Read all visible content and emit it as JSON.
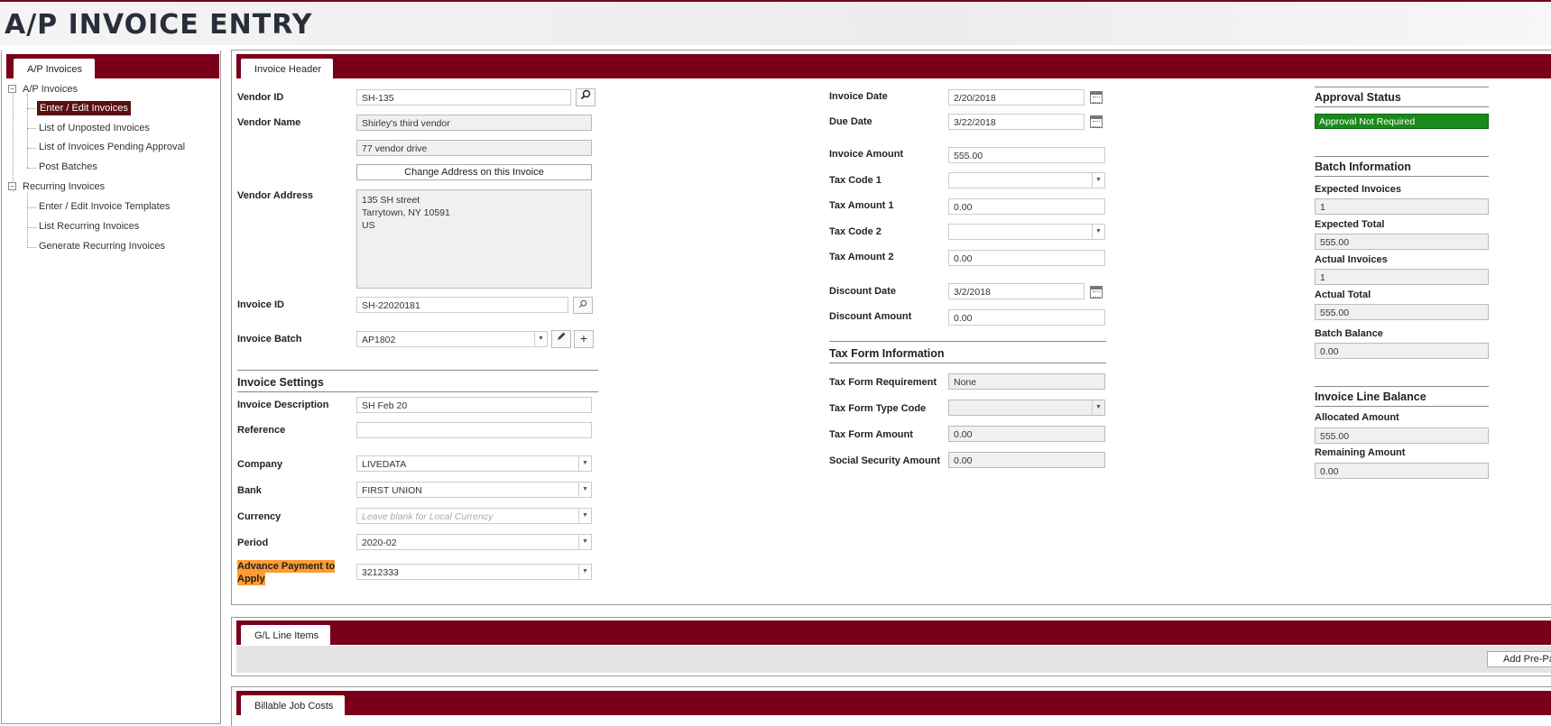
{
  "app": {
    "title": "A/P INVOICE ENTRY"
  },
  "sidebar": {
    "tab": "A/P Invoices",
    "groups": [
      {
        "label": "A/P Invoices",
        "items": [
          "Enter / Edit Invoices",
          "List of Unposted Invoices",
          "List of Invoices Pending Approval",
          "Post Batches"
        ]
      },
      {
        "label": "Recurring Invoices",
        "items": [
          "Enter / Edit Invoice Templates",
          "List Recurring Invoices",
          "Generate Recurring Invoices"
        ]
      }
    ],
    "selected": "Enter / Edit Invoices"
  },
  "header_tab": "Invoice Header",
  "vendor": {
    "id_label": "Vendor ID",
    "id_value": "SH-135",
    "name_label": "Vendor Name",
    "name_value": "Shirley's third vendor",
    "address2_value": "77 vendor drive",
    "change_address_button": "Change Address on this Invoice",
    "address_label": "Vendor Address",
    "address_lines": [
      "135 SH street",
      "Tarrytown, NY 10591",
      "US"
    ]
  },
  "invoice": {
    "id_label": "Invoice ID",
    "id_value": "SH-22020181",
    "batch_label": "Invoice Batch",
    "batch_value": "AP1802"
  },
  "settings": {
    "title": "Invoice Settings",
    "description_label": "Invoice Description",
    "description_value": "SH Feb 20",
    "reference_label": "Reference",
    "reference_value": "",
    "company_label": "Company",
    "company_value": "LIVEDATA",
    "bank_label": "Bank",
    "bank_value": "FIRST UNION",
    "currency_label": "Currency",
    "currency_placeholder": "Leave blank for Local Currency",
    "period_label": "Period",
    "period_value": "2020-02",
    "advance_label_1": "Advance Payment to",
    "advance_label_2": "Apply",
    "advance_value": "3212333"
  },
  "dates": {
    "invoice_date_label": "Invoice Date",
    "invoice_date_value": "2/20/2018",
    "due_date_label": "Due Date",
    "due_date_value": "3/22/2018",
    "invoice_amount_label": "Invoice Amount",
    "invoice_amount_value": "555.00",
    "tax_code1_label": "Tax Code 1",
    "tax_code1_value": "",
    "tax_amount1_label": "Tax Amount 1",
    "tax_amount1_value": "0.00",
    "tax_code2_label": "Tax Code 2",
    "tax_code2_value": "",
    "tax_amount2_label": "Tax Amount 2",
    "tax_amount2_value": "0.00",
    "discount_date_label": "Discount Date",
    "discount_date_value": "3/2/2018",
    "discount_amount_label": "Discount Amount",
    "discount_amount_value": "0.00"
  },
  "tax_form": {
    "title": "Tax Form Information",
    "requirement_label": "Tax Form Requirement",
    "requirement_value": "None",
    "type_code_label": "Tax Form Type Code",
    "type_code_value": "",
    "amount_label": "Tax Form Amount",
    "amount_value": "0.00",
    "ss_label": "Social Security Amount",
    "ss_value": "0.00"
  },
  "approval": {
    "title": "Approval Status",
    "status": "Approval Not Required",
    "status_color": "#1a8a1a"
  },
  "batch_info": {
    "title": "Batch Information",
    "expected_invoices_label": "Expected Invoices",
    "expected_invoices_value": "1",
    "expected_total_label": "Expected Total",
    "expected_total_value": "555.00",
    "actual_invoices_label": "Actual Invoices",
    "actual_invoices_value": "1",
    "actual_total_label": "Actual Total",
    "actual_total_value": "555.00",
    "batch_balance_label": "Batch Balance",
    "batch_balance_value": "0.00"
  },
  "line_balance": {
    "title": "Invoice Line Balance",
    "allocated_label": "Allocated Amount",
    "allocated_value": "555.00",
    "remaining_label": "Remaining Amount",
    "remaining_value": "0.00"
  },
  "gl_tab": "G/L Line Items",
  "add_prepaid_button": "Add Pre-Pai",
  "billable_tab": "Billable Job Costs",
  "colors": {
    "brand": "#7a0019",
    "highlight": "#ff9b30"
  }
}
